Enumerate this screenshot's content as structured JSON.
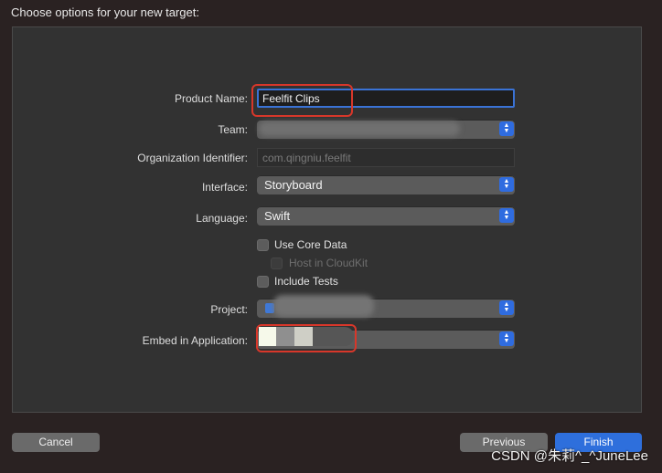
{
  "header": {
    "title": "Choose options for your new target:"
  },
  "form": {
    "product_name": {
      "label": "Product Name:",
      "value": "Feelfit Clips"
    },
    "team": {
      "label": "Team:"
    },
    "org_id": {
      "label": "Organization Identifier:",
      "value": "com.qingniu.feelfit"
    },
    "interface": {
      "label": "Interface:",
      "value": "Storyboard"
    },
    "language": {
      "label": "Language:",
      "value": "Swift"
    },
    "use_core_data": {
      "label": "Use Core Data",
      "checked": false
    },
    "host_in_cloudkit": {
      "label": "Host in CloudKit",
      "checked": false,
      "disabled": true
    },
    "include_tests": {
      "label": "Include Tests",
      "checked": false
    },
    "project": {
      "label": "Project:"
    },
    "embed_in_application": {
      "label": "Embed in Application:"
    }
  },
  "footer": {
    "cancel_label": "Cancel",
    "previous_label": "Previous",
    "finish_label": "Finish"
  },
  "watermark": "CSDN @朱莉^_^JuneLee",
  "colors": {
    "accent": "#2e6fdc",
    "annotation_red": "#d8372a",
    "panel_bg": "#323232",
    "window_bg": "#2a2222"
  }
}
